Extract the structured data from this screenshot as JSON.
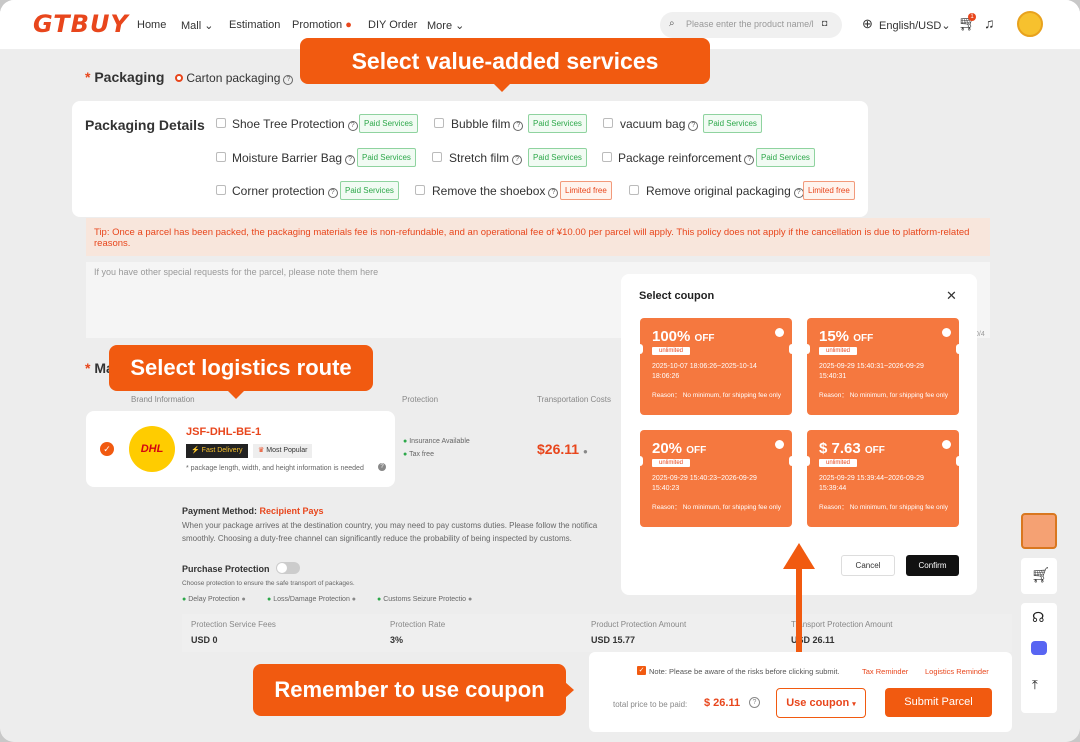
{
  "header": {
    "logo": "GTBUY",
    "nav": [
      "Home",
      "Mall",
      "Estimation",
      "Promotion",
      "DIY Order",
      "More"
    ],
    "search_placeholder": "Please enter the product name/l...",
    "language": "English/USD",
    "cart_count": "1"
  },
  "callouts": {
    "services": "Select value-added services",
    "logistics": "Select logistics route",
    "coupon": "Remember to use coupon"
  },
  "packaging": {
    "label": "Packaging",
    "selected_option": "Carton packaging",
    "details_label": "Packaging Details",
    "options": [
      {
        "label": "Shoe Tree Protection",
        "tag": "Paid Services"
      },
      {
        "label": "Bubble film",
        "tag": "Paid Services"
      },
      {
        "label": "vacuum bag",
        "tag": "Paid Services"
      },
      {
        "label": "Moisture Barrier Bag",
        "tag": "Paid Services"
      },
      {
        "label": "Stretch film",
        "tag": "Paid Services"
      },
      {
        "label": "Package reinforcement",
        "tag": "Paid Services"
      },
      {
        "label": "Corner protection",
        "tag": "Paid Services"
      },
      {
        "label": "Remove the shoebox",
        "tag": "Limited free"
      },
      {
        "label": "Remove original packaging",
        "tag": "Limited free"
      }
    ],
    "tip": "Tip: Once a parcel has been packed, the packaging materials fee is non-refundable, and an operational fee of ¥10.00 per parcel will apply. This policy does not apply if the cancellation is due to platform-related reasons.",
    "note_placeholder": "If you have other special requests for the parcel, please note them here",
    "char_count": "0/4"
  },
  "logistics": {
    "section_label_partial": "Ma",
    "columns": [
      "Brand Information",
      "Protection",
      "Transportation Costs"
    ],
    "route": {
      "name": "JSF-DHL-BE-1",
      "badge1": "Fast Delivery",
      "badge2": "Most Popular",
      "note": "* package length, width, and height information is needed",
      "protection1": "Insurance Available",
      "protection2": "Tax free",
      "cost": "$26.11"
    }
  },
  "payment": {
    "label": "Payment Method:",
    "value": "Recipient Pays",
    "text": "When your package arrives at the destination country, you may need to pay customs duties. Please follow the notifica",
    "text2": "smoothly. Choosing a duty-free channel can significantly reduce the probability of being inspected by customs."
  },
  "purchase_protection": {
    "label": "Purchase Protection",
    "desc": "Choose protection to ensure the safe transport of packages.",
    "items": [
      "Delay Protection",
      "Loss/Damage Protection",
      "Customs Seizure Protectio"
    ],
    "columns": [
      "Protection Service Fees",
      "Protection Rate",
      "Product Protection Amount",
      "Transport Protection Amount"
    ],
    "values": [
      "USD 0",
      "3%",
      "USD 15.77",
      "USD 26.11"
    ]
  },
  "coupon_modal": {
    "title": "Select coupon",
    "coupons": [
      {
        "value": "100%",
        "off": "OFF",
        "limit": "unlimited",
        "dates": "2025-10-07 18:06:26~2025-10-14 18:06:26",
        "reason": "Reason： No minimum, for shipping fee only"
      },
      {
        "value": "15%",
        "off": "OFF",
        "limit": "unlimited",
        "dates": "2025-09-29 15:40:31~2026-09-29 15:40:31",
        "reason": "Reason： No minimum, for shipping fee only"
      },
      {
        "value": "20%",
        "off": "OFF",
        "limit": "unlimited",
        "dates": "2025-09-29 15:40:23~2026-09-29 15:40:23",
        "reason": "Reason： No minimum, for shipping fee only"
      },
      {
        "value": "$ 7.63",
        "off": "OFF",
        "limit": "unlimited",
        "dates": "2025-09-29 15:39:44~2026-09-29 15:39:44",
        "reason": "Reason： No minimum, for shipping fee only"
      }
    ],
    "cancel": "Cancel",
    "confirm": "Confirm"
  },
  "bottom_bar": {
    "risk_note": "Note: Please be aware of the risks before clicking submit.",
    "tax_reminder": "Tax Reminder",
    "logistics_reminder": "Logistics Reminder",
    "total_label": "total price to be paid:",
    "total": "$ 26.11",
    "use_coupon": "Use coupon",
    "submit": "Submit Parcel"
  },
  "colors": {
    "brand": "#e8461c",
    "callout": "#f15a10",
    "coupon": "#f5783f"
  }
}
